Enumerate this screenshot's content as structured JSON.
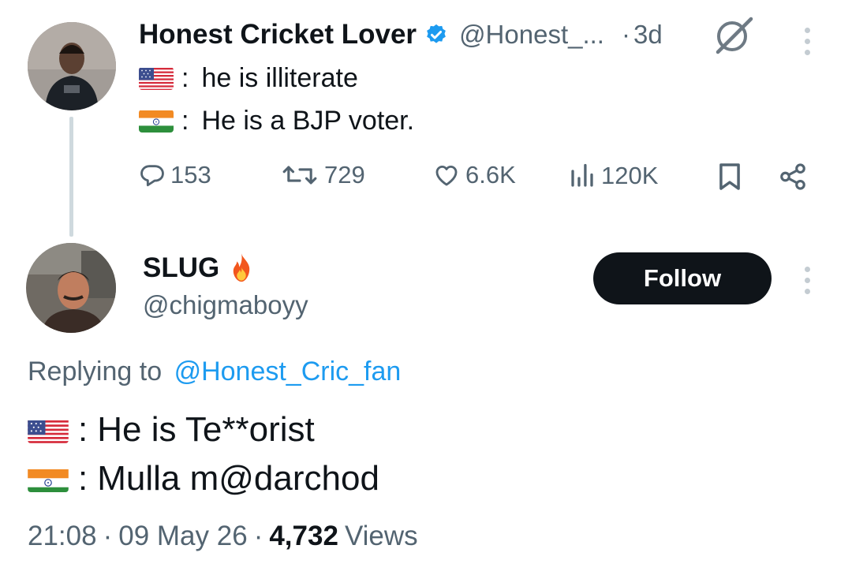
{
  "parent_tweet": {
    "display_name": "Honest Cricket Lover",
    "handle": "@Honest_...",
    "time_sep": "·",
    "time": "3d",
    "lines": [
      {
        "flag": "us-flag",
        "sep": ":",
        "text": "he is illiterate"
      },
      {
        "flag": "india-flag",
        "sep": ":",
        "text": "He is a BJP voter."
      }
    ],
    "stats": {
      "replies": "153",
      "retweets": "729",
      "likes": "6.6K",
      "views": "120K"
    }
  },
  "reply_tweet": {
    "display_name": "SLUG",
    "handle": "@chigmaboyy",
    "follow_label": "Follow",
    "replying_prefix": "Replying to",
    "replying_handle": "@Honest_Cric_fan",
    "lines": [
      {
        "flag": "us-flag",
        "sep": ":",
        "text": "He is Te**orist"
      },
      {
        "flag": "india-flag",
        "sep": ":",
        "text": "Mulla m@darchod"
      }
    ],
    "meta": {
      "time": "21:08",
      "sep1": "·",
      "date": "09 May 26",
      "sep2": "·",
      "views_count": "4,732",
      "views_label": "Views"
    }
  },
  "colors": {
    "accent_blue": "#1d9bf0",
    "verified_badge": "#1d9bf0",
    "text_primary": "#0f1419",
    "text_secondary": "#536471",
    "follow_bg": "#0f1419"
  },
  "icons": [
    "verified-badge-icon",
    "grok-icon",
    "more-icon",
    "reply-icon",
    "retweet-icon",
    "like-icon",
    "views-icon",
    "bookmark-icon",
    "share-icon",
    "fire-icon",
    "us-flag-icon",
    "india-flag-icon"
  ]
}
